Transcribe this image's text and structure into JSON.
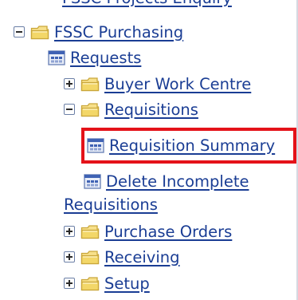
{
  "tree": {
    "cut_item": "FSSC Projects Enquiry",
    "root": {
      "label": "FSSC Purchasing",
      "toggle": "minus"
    },
    "items": [
      {
        "key": "requests",
        "label": "Requests",
        "type": "function"
      },
      {
        "key": "buyer",
        "label": "Buyer Work Centre",
        "type": "folder",
        "toggle": "plus"
      },
      {
        "key": "requisitions",
        "label": "Requisitions",
        "type": "folder",
        "toggle": "minus"
      },
      {
        "key": "req_summary",
        "label": "Requisition Summary",
        "type": "function",
        "highlighted": true
      },
      {
        "key": "delete_incomplete",
        "label_line1": "Delete Incomplete",
        "label_line2": "Requisitions",
        "type": "function"
      },
      {
        "key": "po",
        "label": "Purchase Orders",
        "type": "folder",
        "toggle": "plus"
      },
      {
        "key": "receiving",
        "label": "Receiving",
        "type": "folder",
        "toggle": "plus"
      },
      {
        "key": "setup",
        "label": "Setup",
        "type": "folder",
        "toggle": "plus"
      }
    ]
  },
  "icons": {
    "folder": "folder-icon",
    "function": "function-icon",
    "expand": "plus-toggle-icon",
    "collapse": "minus-toggle-icon"
  },
  "colors": {
    "link": "#1a3d94",
    "highlight_border": "#e41219",
    "folder_fill": "#f3d768",
    "folder_edge": "#c9a63a"
  }
}
